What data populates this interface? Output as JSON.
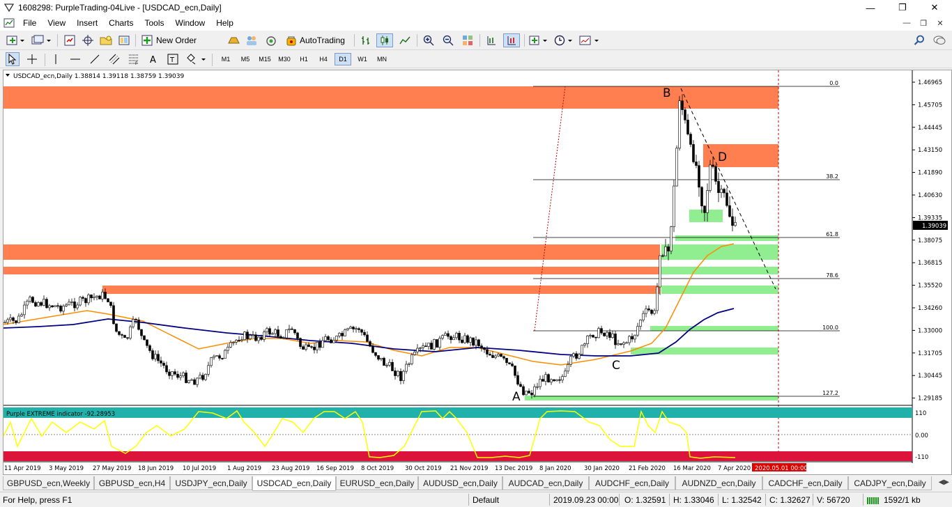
{
  "window": {
    "title": "1608298: PurpleTrading-04Live - [USDCAD_ecn,Daily]",
    "minimize": "—",
    "maximize": "❐",
    "close": "✕"
  },
  "menu": {
    "items": [
      "File",
      "View",
      "Insert",
      "Charts",
      "Tools",
      "Window",
      "Help"
    ],
    "mdi_min": "—",
    "mdi_restore": "❐",
    "mdi_close": "✕"
  },
  "toolbar": {
    "new_order": "New Order",
    "autotrading": "AutoTrading"
  },
  "timeframes": [
    "M1",
    "M5",
    "M15",
    "M30",
    "H1",
    "H4",
    "D1",
    "W1",
    "MN"
  ],
  "active_timeframe": "D1",
  "chart": {
    "info": "USDCAD_ecn,Daily  1.38814 1.39118 1.38759 1.39039",
    "current_price": "1.39039",
    "indicator_label": "Purple EXTREME indicator -92.28953",
    "current_date": "2020.05.01 00:00",
    "wave_labels": [
      "A",
      "B",
      "C",
      "D"
    ],
    "fib_labels": [
      "0.0",
      "38.2",
      "61.8",
      "78.6",
      "100.0",
      "127.2"
    ],
    "price_ticks": [
      "1.46965",
      "1.45705",
      "1.44445",
      "1.43150",
      "1.41890",
      "1.40630",
      "1.39335",
      "1.38075",
      "1.36815",
      "1.35520",
      "1.34260",
      "1.33000",
      "1.31705",
      "1.30445",
      "1.29185"
    ],
    "indicator_ticks": [
      "110",
      "0.00",
      "-110"
    ],
    "date_ticks": [
      "11 Apr 2019",
      "3 May 2019",
      "27 May 2019",
      "18 Jun 2019",
      "10 Jul 2019",
      "1 Aug 2019",
      "23 Aug 2019",
      "16 Sep 2019",
      "8 Oct 2019",
      "30 Oct 2019",
      "21 Nov 2019",
      "13 Dec 2019",
      "8 Jan 2020",
      "30 Jan 2020",
      "21 Feb 2020",
      "16 Mar 2020",
      "7 Apr 2020"
    ],
    "colors": {
      "zone_red": "#ff7f50",
      "zone_green": "#90ee90",
      "candle": "#000000",
      "ma_fast": "#ff8c00",
      "ma_slow": "#000080",
      "indicator_line": "#ffff00",
      "band_top": "#20b2aa",
      "band_bottom": "#dc143c",
      "current_date_bg": "#e00000"
    }
  },
  "tabs": [
    "GBPUSD_ecn,Weekly",
    "GBPUSD_ecn,H4",
    "USDJPY_ecn,Daily",
    "USDCAD_ecn,Daily",
    "EURUSD_ecn,Daily",
    "AUDUSD_ecn,Daily",
    "AUDCAD_ecn,Daily",
    "AUDCHF_ecn,Daily",
    "AUDNZD_ecn,Daily",
    "CADCHF_ecn,Daily",
    "CADJPY_ecn,Daily"
  ],
  "active_tab": "USDCAD_ecn,Daily",
  "status": {
    "help": "For Help, press F1",
    "profile": "Default",
    "datetime": "2019.09.23 00:00",
    "open": "O: 1.32591",
    "high": "H: 1.33046",
    "low": "L: 1.32542",
    "close": "C: 1.32627",
    "volume": "V: 56720",
    "traffic": "1592/1 kb"
  }
}
